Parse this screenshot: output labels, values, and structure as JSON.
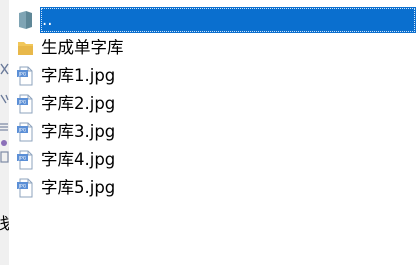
{
  "left_strip": {
    "partial_char": "栈"
  },
  "file_list": {
    "items": [
      {
        "name": "..",
        "icon": "folder-up-icon",
        "selected": true
      },
      {
        "name": "生成单字库",
        "icon": "folder-icon",
        "selected": false
      },
      {
        "name": "字库1.jpg",
        "icon": "jpg-file-icon",
        "selected": false
      },
      {
        "name": "字库2.jpg",
        "icon": "jpg-file-icon",
        "selected": false
      },
      {
        "name": "字库3.jpg",
        "icon": "jpg-file-icon",
        "selected": false
      },
      {
        "name": "字库4.jpg",
        "icon": "jpg-file-icon",
        "selected": false
      },
      {
        "name": "字库5.jpg",
        "icon": "jpg-file-icon",
        "selected": false
      }
    ]
  },
  "colors": {
    "selection": "#0a6fcf",
    "folder": "#e8b84a",
    "folder_up": "#7fa4b4",
    "jpg_badge": "#5b8fd6"
  }
}
